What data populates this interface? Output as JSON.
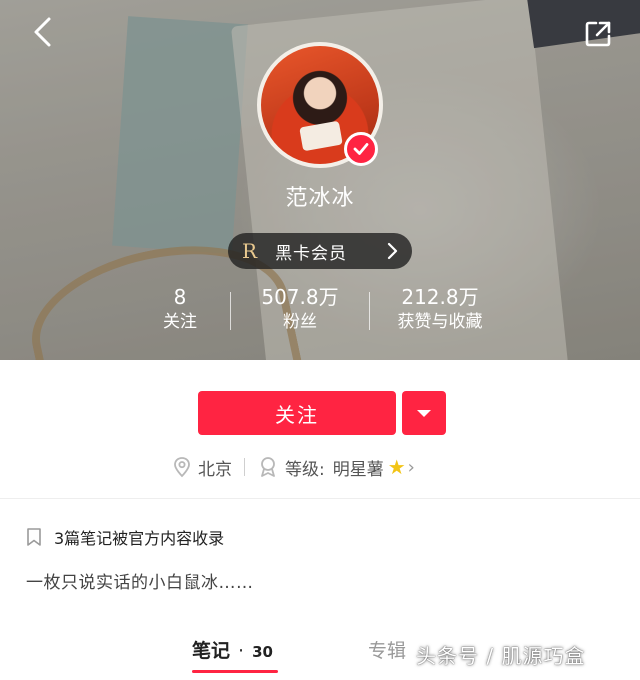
{
  "header": {
    "back_icon": "chevron-left-icon",
    "share_icon": "share-icon"
  },
  "profile": {
    "name": "范冰冰",
    "verified": true,
    "vip": {
      "logo": "R",
      "label": "黑卡会员",
      "arrow": "›"
    },
    "stats": [
      {
        "value": "8",
        "label": "关注"
      },
      {
        "value": "507.8万",
        "label": "粉丝"
      },
      {
        "value": "212.8万",
        "label": "获赞与收藏"
      }
    ]
  },
  "actions": {
    "follow_label": "关注",
    "more_icon": "dropdown-icon"
  },
  "meta": {
    "location": "北京",
    "level_label": "等级:",
    "level_value": "明星薯",
    "level_star": "★",
    "level_chevron": "›"
  },
  "collection_notice": "3篇笔记被官方内容收录",
  "bio": "一枚只说实话的小白鼠冰……",
  "tabs": {
    "notes_label": "笔记",
    "notes_dot": "·",
    "notes_count": "30",
    "album_label": "专辑"
  },
  "watermark": "头条号 / 肌源巧盒",
  "colors": {
    "brand_red": "#ff2442",
    "vip_gold": "#e9c98f",
    "star": "#f2c416"
  }
}
